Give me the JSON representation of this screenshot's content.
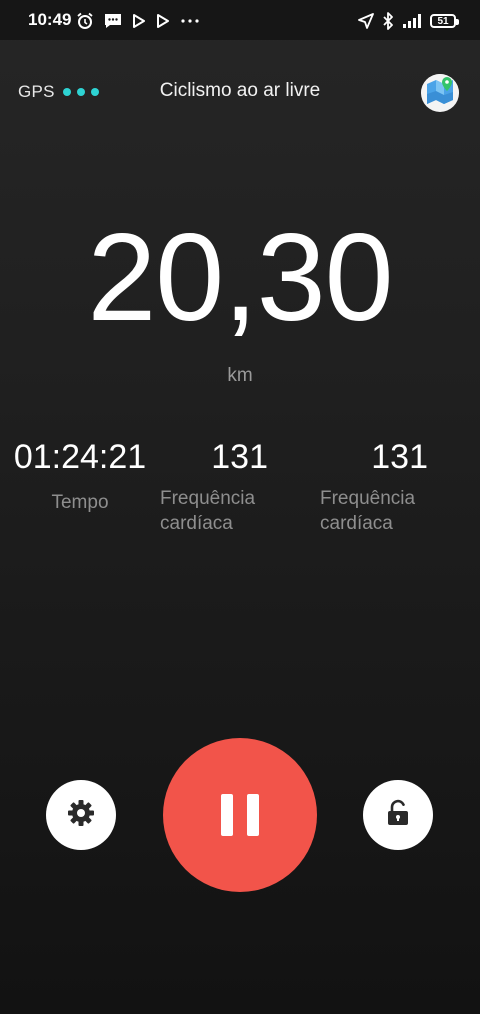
{
  "status_bar": {
    "time": "10:49",
    "battery": "51",
    "icons_left": [
      "alarm-icon",
      "message-icon",
      "play-store-icon",
      "play-store-icon",
      "more-dots-icon"
    ],
    "icons_right": [
      "location-arrow-icon",
      "bluetooth-icon",
      "signal-icon",
      "battery-icon"
    ]
  },
  "header": {
    "gps_label": "GPS",
    "gps_dots_color": "#2ed3d3",
    "title": "Ciclismo ao ar livre",
    "map_button_icon": "map-icon"
  },
  "main": {
    "distance_value": "20,30",
    "distance_unit": "km"
  },
  "stats": [
    {
      "value": "01:24:21",
      "label": "Tempo"
    },
    {
      "value": "131",
      "label": "Frequência cardíaca"
    },
    {
      "value": "131",
      "label": "Frequência cardíaca"
    }
  ],
  "controls": {
    "settings_icon": "gear-icon",
    "pause_icon": "pause-icon",
    "lock_icon": "unlock-icon",
    "pause_color": "#f2544a"
  }
}
